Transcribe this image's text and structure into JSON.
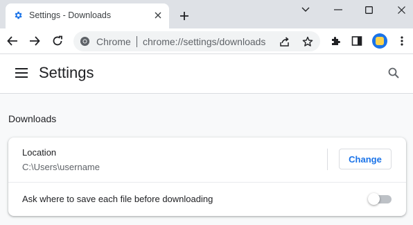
{
  "tab": {
    "title": "Settings - Downloads",
    "favicon": "gear-icon"
  },
  "window_controls": [
    "chevron-down-icon",
    "minimize-icon",
    "maximize-icon",
    "close-icon"
  ],
  "toolbar": {
    "chip_label": "Chrome",
    "url": "chrome://settings/downloads"
  },
  "settings": {
    "title": "Settings"
  },
  "downloads": {
    "section_title": "Downloads",
    "location_label": "Location",
    "location_value": "C:\\Users\\username",
    "change_label": "Change",
    "ask_label": "Ask where to save each file before downloading",
    "ask_enabled": false
  },
  "colors": {
    "accent": "#1a73e8",
    "tabstrip": "#dee1e6",
    "page_bg": "#f8f9fa"
  }
}
